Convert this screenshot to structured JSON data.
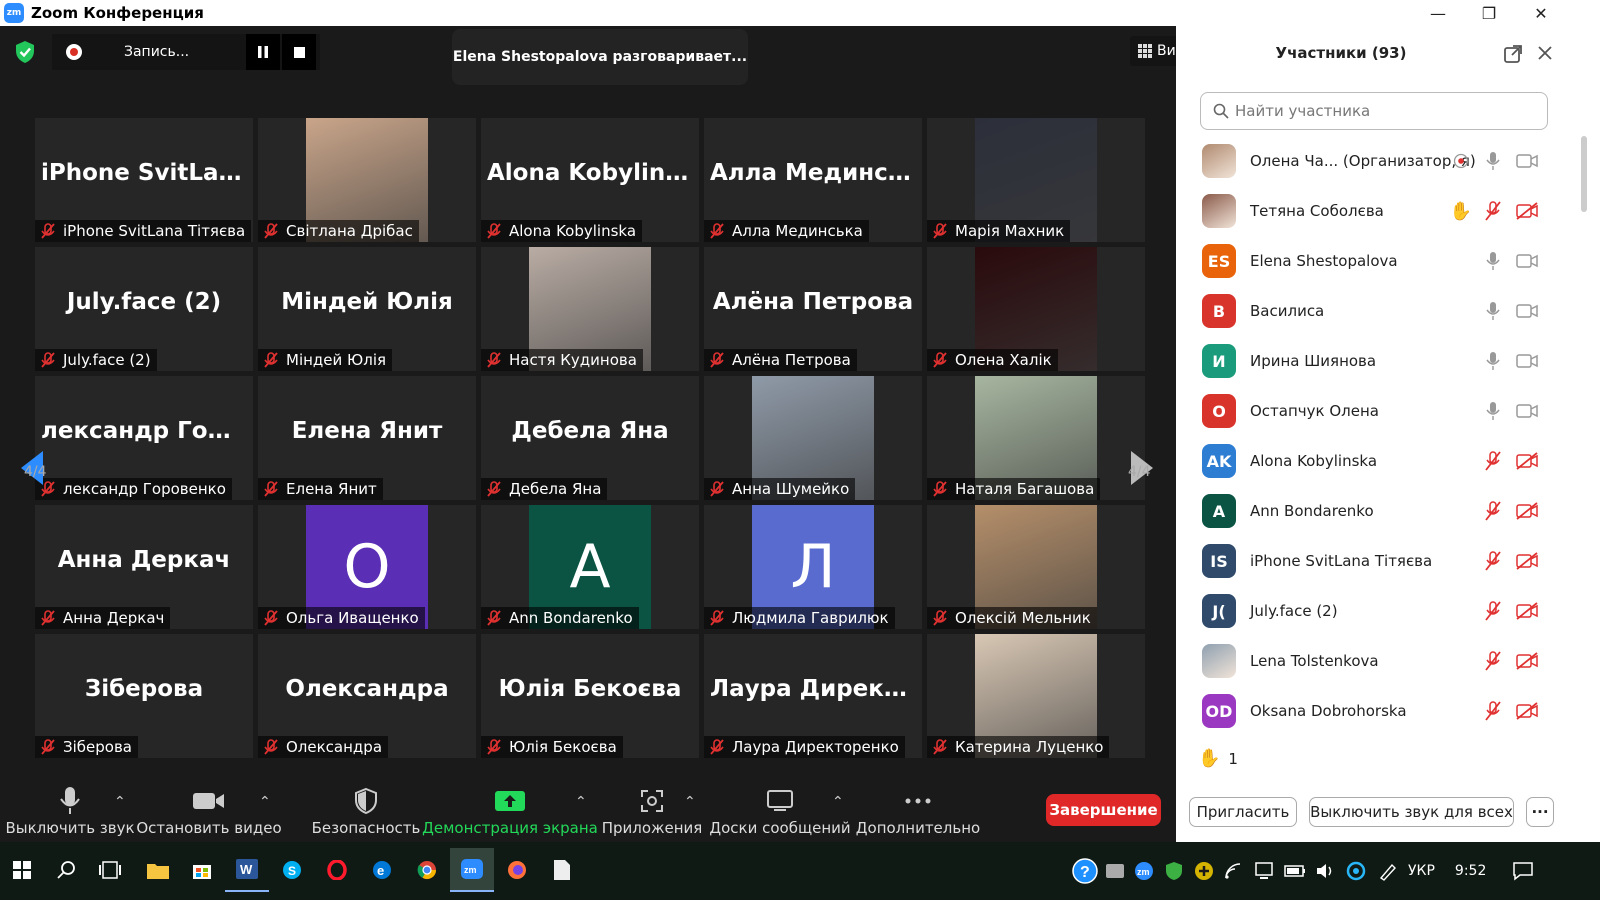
{
  "window": {
    "logo_text": "zm",
    "title": "Zoom Конференция",
    "controls": {
      "minimize": "—",
      "maximize": "❐",
      "close": "✕"
    }
  },
  "meeting": {
    "recording_label": "Запись...",
    "speaking_banner": "Elena Shestopalova разговаривает...",
    "view_label": "Вид",
    "page_indicator_left": "4/4",
    "page_indicator_right": "4/4"
  },
  "tiles": [
    {
      "big": "iPhone  SvitLana...",
      "name": "iPhone SvitLana Тітяєва",
      "kind": "text"
    },
    {
      "big": "",
      "name": "Світлана Дрібас",
      "kind": "photo",
      "photo_color": "#c9a58a"
    },
    {
      "big": "Alona Kobylinska",
      "name": "Alona Kobylinska",
      "kind": "text"
    },
    {
      "big": "Алла Мединська",
      "name": "Алла Мединська",
      "kind": "text"
    },
    {
      "big": "",
      "name": "Марія Махник",
      "kind": "photo",
      "photo_color": "#2c2f3a"
    },
    {
      "big": "July.face (2)",
      "name": "July.face (2)",
      "kind": "text"
    },
    {
      "big": "Міндей Юлія",
      "name": "Міндей Юлія",
      "kind": "text"
    },
    {
      "big": "",
      "name": "Настя Кудинова",
      "kind": "photo",
      "photo_color": "#b9aca4"
    },
    {
      "big": "Алёна Петрова",
      "name": "Алёна Петрова",
      "kind": "text"
    },
    {
      "big": "",
      "name": "Олена Халік",
      "kind": "photo",
      "photo_color": "#2a0a0c"
    },
    {
      "big": "лександр  Гор...",
      "name": "лександр Горовенко",
      "kind": "text"
    },
    {
      "big": "Елена Янит",
      "name": "Елена Янит",
      "kind": "text"
    },
    {
      "big": "Дебела Яна",
      "name": "Дебела Яна",
      "kind": "text"
    },
    {
      "big": "",
      "name": "Анна Шумейко",
      "kind": "photo",
      "photo_color": "#8f9aa8"
    },
    {
      "big": "",
      "name": "Наталя Багашова",
      "kind": "photo",
      "photo_color": "#a7b6a0"
    },
    {
      "big": "Анна Деркач",
      "name": "Анна Деркач",
      "kind": "text"
    },
    {
      "big": "",
      "name": "Ольга Иващенко",
      "kind": "avatar",
      "letter": "О",
      "avatar_color": "#5b2fb5"
    },
    {
      "big": "",
      "name": "Ann Bondarenko",
      "kind": "avatar",
      "letter": "A",
      "avatar_color": "#0b5444"
    },
    {
      "big": "",
      "name": "Людмила Гаврилюк",
      "kind": "avatar",
      "letter": "Л",
      "avatar_color": "#5a6bd0"
    },
    {
      "big": "",
      "name": "Олексій Мельник",
      "kind": "photo",
      "photo_color": "#b58f6a"
    },
    {
      "big": "Зіберова",
      "name": "Зіберова",
      "kind": "text"
    },
    {
      "big": "Олександра",
      "name": "Олександра",
      "kind": "text"
    },
    {
      "big": "Юлія Бекоєва",
      "name": "Юлія Бекоєва",
      "kind": "text"
    },
    {
      "big": "Лаура  Директо...",
      "name": "Лаура Директоренко",
      "kind": "text"
    },
    {
      "big": "",
      "name": "Катерина Луценко",
      "kind": "photo",
      "photo_color": "#d8c7b4"
    }
  ],
  "toolbar": {
    "mute": "Выключить звук",
    "video": "Остановить видео",
    "security": "Безопасность",
    "share": "Демонстрация экрана",
    "apps": "Приложения",
    "whiteboards": "Доски сообщений",
    "more": "Дополнительно",
    "end": "Завершение",
    "colors": {
      "share_green": "#23d959",
      "end_red": "#e02828"
    }
  },
  "participants_panel": {
    "title": "Участники (93)",
    "search_placeholder": "Найти участника",
    "participants": [
      {
        "name": "Олена Ча...  (Организатор, я)",
        "avatar": "photo",
        "color": "#b08a70",
        "mic": "on",
        "cam": "on",
        "extra": "record"
      },
      {
        "name": "Тетяна Соболєва",
        "avatar": "photo",
        "color": "#8a5a4a",
        "mic": "off",
        "cam": "off",
        "extra": "hand"
      },
      {
        "name": "Elena Shestopalova",
        "avatar": "ES",
        "color": "#e8630a",
        "mic": "on",
        "cam": "on",
        "extra": ""
      },
      {
        "name": "Василиса",
        "avatar": "В",
        "color": "#d9342b",
        "mic": "on",
        "cam": "on",
        "extra": ""
      },
      {
        "name": "Ирина Шиянова",
        "avatar": "И",
        "color": "#1a9c7c",
        "mic": "on",
        "cam": "on",
        "extra": ""
      },
      {
        "name": "Остапчук Олена",
        "avatar": "О",
        "color": "#d9342b",
        "mic": "on",
        "cam": "on",
        "extra": ""
      },
      {
        "name": "Alona Kobylinska",
        "avatar": "AK",
        "color": "#2d7dd2",
        "mic": "off",
        "cam": "off",
        "extra": ""
      },
      {
        "name": "Ann Bondarenko",
        "avatar": "A",
        "color": "#0b5444",
        "mic": "off",
        "cam": "off",
        "extra": ""
      },
      {
        "name": "iPhone SvitLana Тітяєва",
        "avatar": "IS",
        "color": "#2f4a6b",
        "mic": "off",
        "cam": "off",
        "extra": ""
      },
      {
        "name": "July.face (2)",
        "avatar": "J(",
        "color": "#2f4a6b",
        "mic": "off",
        "cam": "off",
        "extra": ""
      },
      {
        "name": "Lena Tolstenkova",
        "avatar": "photo",
        "color": "#8fa0b0",
        "mic": "off",
        "cam": "off",
        "extra": ""
      },
      {
        "name": "Oksana Dobrohorska",
        "avatar": "OD",
        "color": "#9b38c2",
        "mic": "off",
        "cam": "off",
        "extra": ""
      }
    ],
    "raised_hands_count": "1",
    "invite": "Пригласить",
    "mute_all": "Выключить звук для всех",
    "more": "···"
  },
  "taskbar": {
    "language": "УКР",
    "time": "9:52"
  }
}
